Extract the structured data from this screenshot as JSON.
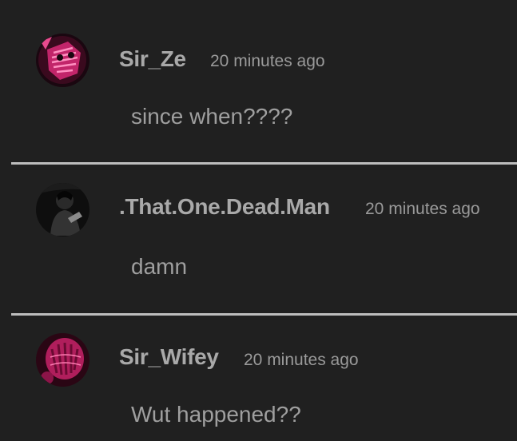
{
  "comments": [
    {
      "avatar_icon": "user-avatar-pink-mask-icon",
      "username": "Sir_Ze",
      "time": "20 minutes ago",
      "text": "since when????"
    },
    {
      "avatar_icon": "user-avatar-dark-figure-icon",
      "username": ".That.One.Dead.Man",
      "time": "20 minutes ago",
      "text": "damn"
    },
    {
      "avatar_icon": "user-avatar-pink-glove-icon",
      "username": "Sir_Wifey",
      "time": "20 minutes ago",
      "text": "Wut happened??"
    }
  ],
  "colors": {
    "background": "#202020",
    "username": "#a9a9a9",
    "timestamp": "#9a9a9a",
    "message": "#9f9f9f",
    "divider": "#bdbdbd",
    "accent_pink": "#d6337a"
  }
}
